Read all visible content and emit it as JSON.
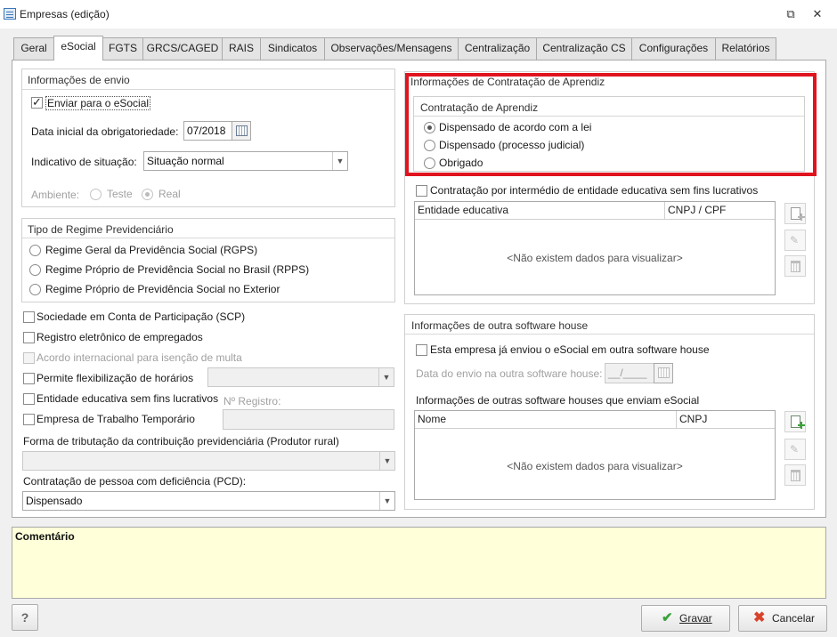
{
  "window": {
    "title": "Empresas (edição)",
    "restore_glyph": "⧉",
    "close_glyph": "✕"
  },
  "tabs": [
    {
      "label": "Geral"
    },
    {
      "label": "eSocial"
    },
    {
      "label": "FGTS"
    },
    {
      "label": "GRCS/CAGED"
    },
    {
      "label": "RAIS"
    },
    {
      "label": "Sindicatos"
    },
    {
      "label": "Observações/Mensagens"
    },
    {
      "label": "Centralização"
    },
    {
      "label": "Centralização CS"
    },
    {
      "label": "Configurações"
    },
    {
      "label": "Relatórios"
    }
  ],
  "active_tab": "eSocial",
  "envio": {
    "title": "Informações de envio",
    "enviar_label": "Enviar para o eSocial",
    "enviar_checked": true,
    "data_label": "Data inicial da obrigatoriedade:",
    "data_value": "07/2018",
    "situacao_label": "Indicativo de situação:",
    "situacao_value": "Situação normal",
    "ambiente_label": "Ambiente:",
    "ambiente_teste": "Teste",
    "ambiente_real": "Real",
    "ambiente_selected": "Real"
  },
  "regime": {
    "title": "Tipo de Regime Previdenciário",
    "options": [
      "Regime Geral da Previdência Social (RGPS)",
      "Regime Próprio de Previdência Social no Brasil (RPPS)",
      "Regime Próprio de Previdência Social no Exterior"
    ]
  },
  "flags": {
    "scp": "Sociedade em Conta de Participação (SCP)",
    "registro_eletronico": "Registro eletrônico de empregados",
    "acordo_internacional": "Acordo internacional para isenção de multa",
    "flexibilizacao": "Permite flexibilização de horários",
    "entidade_educativa": "Entidade educativa sem fins lucrativos",
    "registro_label": "Nº Registro:",
    "trabalho_temporario": "Empresa de Trabalho Temporário"
  },
  "tributacao": {
    "label": "Forma de tributação da contribuição previdenciária (Produtor rural)",
    "value": ""
  },
  "pcd": {
    "label": "Contratação de pessoa com deficiência (PCD):",
    "value": "Dispensado"
  },
  "aprendiz": {
    "outer_title": "Informações de Contratação de Aprendiz",
    "inner_title": "Contratação de Aprendiz",
    "options": [
      "Dispensado de acordo com a lei",
      "Dispensado (processo judicial)",
      "Obrigado"
    ],
    "selected_index": 0,
    "intermedio_label": "Contratação por intermédio de entidade educativa sem fins lucrativos",
    "grid": {
      "columns": [
        "Entidade educativa",
        "CNPJ / CPF"
      ],
      "empty_text": "<Não existem dados para visualizar>"
    }
  },
  "software_house": {
    "title": "Informações de outra software house",
    "enviou_label": "Esta empresa já enviou o eSocial em outra software house",
    "data_label": "Data do envio na outra software house:",
    "data_placeholder": "__/____",
    "lista_label": "Informações de outras software houses que enviam eSocial",
    "grid": {
      "columns": [
        "Nome",
        "CNPJ"
      ],
      "empty_text": "<Não existem dados para visualizar>"
    }
  },
  "comment": {
    "label": "Comentário"
  },
  "footer": {
    "help_label": "?",
    "save_label": "Gravar",
    "cancel_label": "Cancelar"
  },
  "colors": {
    "highlight": "#e0141e",
    "comment_bg": "#ffffd9",
    "save_icon": "#3aa23a",
    "cancel_icon": "#d9432c"
  }
}
